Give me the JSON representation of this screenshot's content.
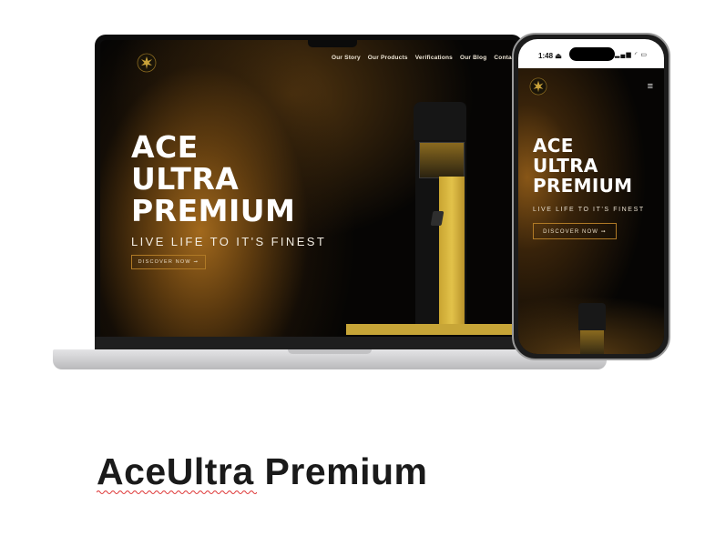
{
  "laptop": {
    "nav": [
      "Our Story",
      "Our Products",
      "Verifications",
      "Our Blog",
      "Contact"
    ],
    "hero": {
      "title_lines": [
        "ACE",
        "ULTRA",
        "PREMIUM"
      ],
      "tagline": "LIVE LIFE TO IT'S FINEST",
      "cta": "DISCOVER NOW ➞"
    }
  },
  "phone": {
    "status": {
      "time": "1:48 ⏏",
      "icons": "▂▄▆ ◜ ▭"
    },
    "menu_icon": "hamburger-icon",
    "menu_glyph": "≡",
    "hero": {
      "title_lines": [
        "ACE",
        "ULTRA",
        "PREMIUM"
      ],
      "tagline": "LIVE LIFE TO IT'S FINEST",
      "cta": "DISCOVER NOW ➞"
    }
  },
  "caption": "AceUltra Premium",
  "colors": {
    "accent_gold": "#c7a537",
    "bronze": "#b07a26",
    "background": "#060504",
    "spellcheck": "#d33"
  }
}
